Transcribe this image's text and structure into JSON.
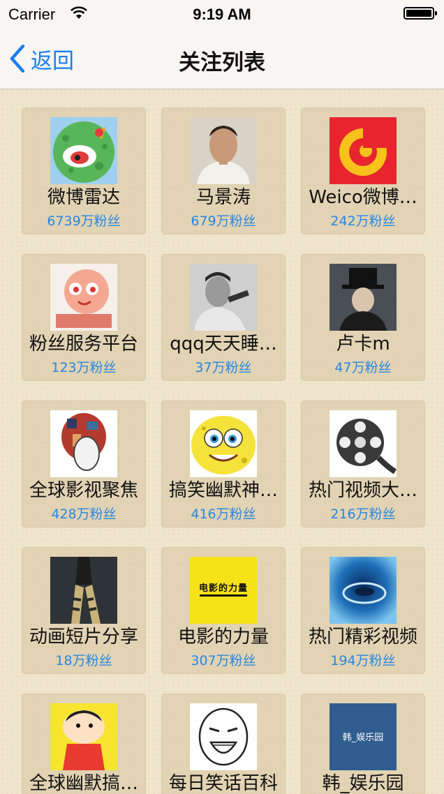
{
  "status_bar": {
    "carrier": "Carrier",
    "time": "9:19 AM"
  },
  "nav": {
    "back_label": "返回",
    "title": "关注列表"
  },
  "accounts": [
    {
      "name": "微博雷达",
      "fans": "6739万粉丝",
      "icon": "weibo-radar-icon"
    },
    {
      "name": "马景涛",
      "fans": "679万粉丝",
      "icon": "portrait-photo"
    },
    {
      "name": "Weico微博…",
      "fans": "242万粉丝",
      "icon": "weico-logo"
    },
    {
      "name": "粉丝服务平台",
      "fans": "123万粉丝",
      "icon": "fan-service-mascot"
    },
    {
      "name": "qqq天天睡…",
      "fans": "37万粉丝",
      "icon": "singer-photo"
    },
    {
      "name": "卢卡m",
      "fans": "47万粉丝",
      "icon": "top-hat-photo"
    },
    {
      "name": "全球影视聚焦",
      "fans": "428万粉丝",
      "icon": "collage-head-art"
    },
    {
      "name": "搞笑幽默神…",
      "fans": "416万粉丝",
      "icon": "spongebob-face"
    },
    {
      "name": "热门视频大…",
      "fans": "216万粉丝",
      "icon": "film-reel-icon"
    },
    {
      "name": "动画短片分享",
      "fans": "18万粉丝",
      "icon": "legs-photo"
    },
    {
      "name": "电影的力量",
      "fans": "307万粉丝",
      "icon": "movie-power-logo",
      "logo_text": "电影的力量"
    },
    {
      "name": "热门精彩视频",
      "fans": "194万粉丝",
      "icon": "water-drop-photo"
    },
    {
      "name": "全球幽默搞…",
      "fans": "",
      "icon": "crayon-shin-chan"
    },
    {
      "name": "每日笑话百科",
      "fans": "",
      "icon": "rage-face-icon"
    },
    {
      "name": "韩_娱乐园",
      "fans": "",
      "icon": "korea-ent-logo",
      "logo_text": "韩_娱乐园"
    }
  ]
}
